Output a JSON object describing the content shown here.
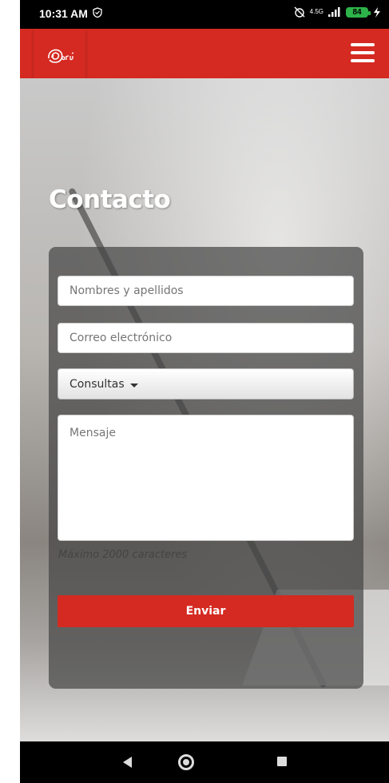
{
  "status_bar": {
    "time": "10:31 AM",
    "network": "4.5G",
    "battery": "84"
  },
  "header": {
    "logo_text": "Perú",
    "menu_icon": "hamburger-menu-icon",
    "brand_color": "#d42a21"
  },
  "page": {
    "title": "Contacto"
  },
  "form": {
    "name_placeholder": "Nombres y apellidos",
    "email_placeholder": "Correo electrónico",
    "subject_selected": "Consultas",
    "message_placeholder": "Mensaje",
    "hint": "Máximo 2000 caracteres",
    "submit_label": "Enviar"
  }
}
